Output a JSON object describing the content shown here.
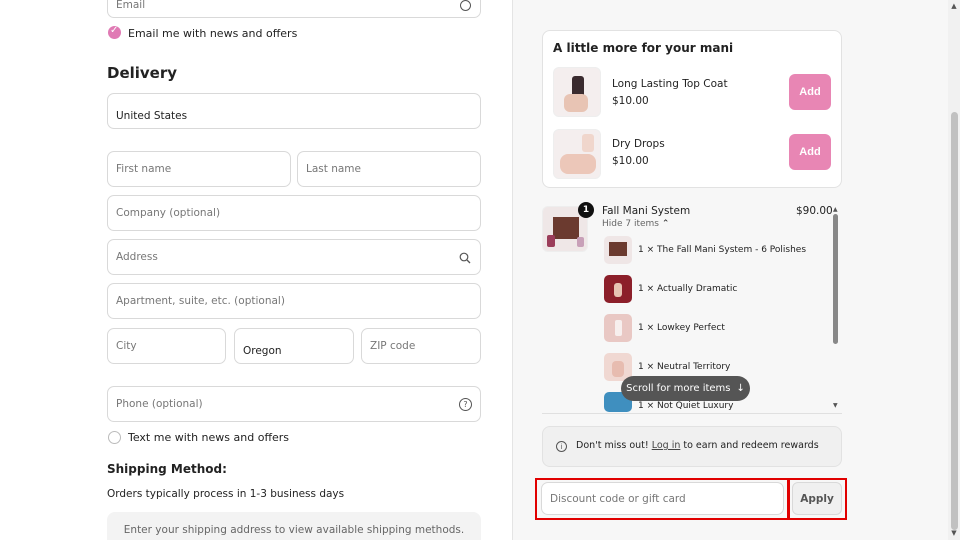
{
  "email": {
    "placeholder": "Email",
    "checkbox_label": "Email me with news and offers"
  },
  "delivery": {
    "heading": "Delivery",
    "country": "United States",
    "first_name_placeholder": "First name",
    "last_name_placeholder": "Last name",
    "company_placeholder": "Company (optional)",
    "address_placeholder": "Address",
    "apartment_placeholder": "Apartment, suite, etc. (optional)",
    "city_placeholder": "City",
    "state_value": "Oregon",
    "zip_placeholder": "ZIP code",
    "phone_placeholder": "Phone (optional)",
    "text_checkbox_label": "Text me with news and offers"
  },
  "shipping": {
    "heading": "Shipping Method:",
    "note": "Orders typically process in 1-3 business days",
    "placeholder": "Enter your shipping address to view available shipping methods."
  },
  "upsell": {
    "title": "A little more for your mani",
    "items": [
      {
        "name": "Long Lasting Top Coat",
        "price": "$10.00",
        "button": "Add"
      },
      {
        "name": "Dry Drops",
        "price": "$10.00",
        "button": "Add"
      }
    ]
  },
  "order": {
    "badge": "1",
    "name": "Fall Mani System",
    "price": "$90.00",
    "toggle": "Hide 7 items",
    "lines": [
      "1 × The Fall Mani System - 6 Polishes",
      "1 × Actually Dramatic",
      "1 × Lowkey Perfect",
      "1 × Neutral Territory",
      "1 × Not Quiet Luxury"
    ],
    "scroll_hint": "Scroll for more items"
  },
  "rewards": {
    "prefix": "Don't miss out! ",
    "link": "Log in",
    "suffix": " to earn and redeem rewards"
  },
  "discount": {
    "placeholder": "Discount code or gift card",
    "button": "Apply"
  },
  "colors": {
    "accent": "#e886b4",
    "highlight": "#e10000"
  }
}
